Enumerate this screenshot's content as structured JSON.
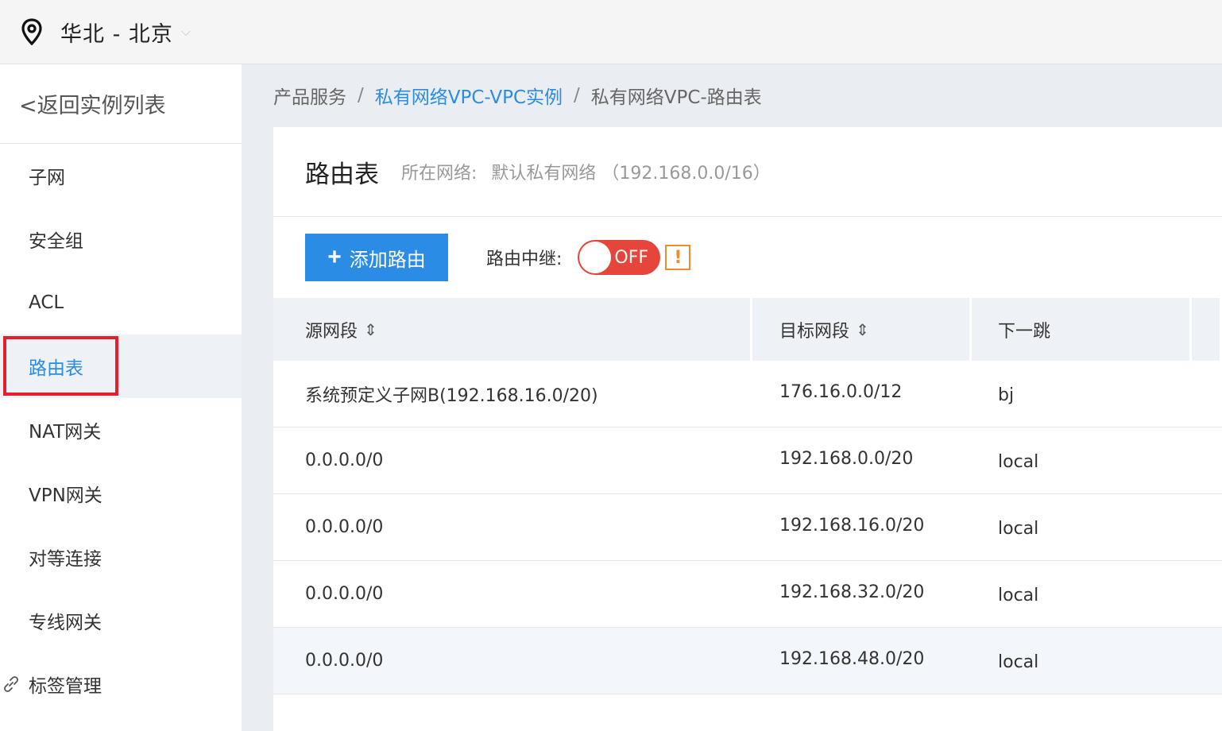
{
  "header": {
    "region": "华北 - 北京",
    "location_icon": "map-pin-icon",
    "caret_icon": "chevron-down-icon"
  },
  "sidebar": {
    "back_label": "<返回实例列表",
    "items": [
      {
        "label": "子网"
      },
      {
        "label": "安全组"
      },
      {
        "label": "ACL"
      },
      {
        "label": "路由表",
        "active": true
      },
      {
        "label": "NAT网关"
      },
      {
        "label": "VPN网关"
      },
      {
        "label": "对等连接"
      },
      {
        "label": "专线网关"
      },
      {
        "label": "标签管理",
        "icon": "link-icon"
      }
    ]
  },
  "breadcrumb": {
    "items": [
      "产品服务",
      "私有网络VPC-VPC实例",
      "私有网络VPC-路由表"
    ],
    "separator": "/"
  },
  "panel": {
    "title": "路由表",
    "network_label": "所在网络:",
    "network_value": "默认私有网络 （192.168.0.0/16）"
  },
  "toolbar": {
    "add_button": "添加路由",
    "add_icon": "plus-icon",
    "relay_label": "路由中继:",
    "relay_toggle": "OFF",
    "warn_symbol": "!"
  },
  "table": {
    "headers": [
      "源网段",
      "目标网段",
      "下一跳",
      ""
    ],
    "sort_symbol": "⇕",
    "rows": [
      {
        "src": "系统预定义子网B(192.168.16.0/20)",
        "dst": "176.16.0.0/12",
        "hop": "bj"
      },
      {
        "src": "0.0.0.0/0",
        "dst": "192.168.0.0/20",
        "hop": "local"
      },
      {
        "src": "0.0.0.0/0",
        "dst": "192.168.16.0/20",
        "hop": "local"
      },
      {
        "src": "0.0.0.0/0",
        "dst": "192.168.32.0/20",
        "hop": "local"
      },
      {
        "src": "0.0.0.0/0",
        "dst": "192.168.48.0/20",
        "hop": "local"
      }
    ]
  },
  "colors": {
    "accent": "#2b8ce6",
    "toggle_off": "#e5453a",
    "warn": "#f08c2e",
    "highlight_box": "#e5202c"
  }
}
